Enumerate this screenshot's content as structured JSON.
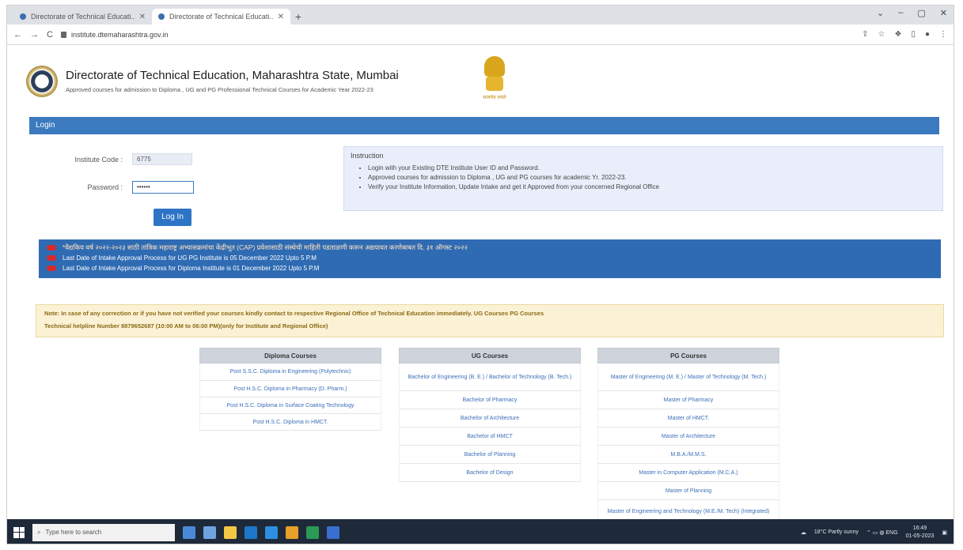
{
  "browser": {
    "tabs": [
      {
        "title": "Directorate of Technical Educati...",
        "active": false
      },
      {
        "title": "Directorate of Technical Educati...",
        "active": true
      }
    ],
    "new_tab": "+",
    "window_controls": [
      "⌄",
      "–",
      "▢",
      "✕"
    ],
    "url": "institute.dtemaharashtra.gov.in",
    "nav": [
      "←",
      "→",
      "C"
    ]
  },
  "header": {
    "title": "Directorate of Technical Education, Maharashtra State, Mumbai",
    "subtitle": "Approved courses for admission to Diploma , UG and PG Professional Technical Courses for Academic Year 2022-23",
    "emblem_text": "सत्यमेव जयते"
  },
  "login": {
    "bar_label": "Login",
    "institute_code_label": "Institute Code :",
    "institute_code_value": "6775",
    "password_label": "Password :",
    "password_value": "••••••",
    "button_label": "Log In"
  },
  "instruction": {
    "heading": "Instruction",
    "items": [
      "Login with your Existing DTE Institute User ID and Password.",
      "Approved courses for admission to Diploma , UG and PG courses for academic Yr. 2022-23.",
      "Verify your Institute Information, Update Intake and get it Approved from your concerned Regional Office"
    ]
  },
  "notices": [
    "*वैद्यकिय वर्ष २०२२-२०२३ साठी तांत्रिक महाराष्ट्र अभ्यासक्रमांचा केंद्रीभूत (CAP) प्रवेशासाठी संस्थेची माहिती पडताळणी करून अद्ययावत करणेबाबत दि. ३१ ऑगस्ट २०२२",
    "Last Date of Intake Approval Process for UG PG Institute is 05 December 2022 Upto 5 P.M",
    "Last Date of Intake Approval Process for Diploma Institute is 01 December 2022 Upto 5 P.M"
  ],
  "note": {
    "line1": "Note: In case of any correction or if you have not verified your courses kindly contact to respective Regional Office of Technical Education immediately. UG Courses PG Courses",
    "line2": "Technical helpline Number 8879652687 (10:00 AM to 06:00 PM)(only for Institute and Regional Office)"
  },
  "courses": {
    "diploma": {
      "header": "Diploma Courses",
      "items": [
        "Post S.S.C. Diploma in Engineering (Polytechnic)",
        "Post H.S.C. Diploma in Pharmacy (D. Pharm.)",
        "Post H.S.C. Diploma in Surface Coating Technology",
        "Post H.S.C. Diploma in HMCT."
      ]
    },
    "ug": {
      "header": "UG Courses",
      "items": [
        "Bachelor of Engineering (B. E.) / Bachelor of Technology (B. Tech.)",
        "Bachelor of Pharmacy",
        "Bachelor of Architecture",
        "Bachelor of HMCT",
        "Bachelor of Planning",
        "Bachelor of Design"
      ]
    },
    "pg": {
      "header": "PG Courses",
      "items": [
        "Master of Engineering (M. E.) / Master of Technology (M. Tech.)",
        "Master of Pharmacy",
        "Master of HMCT.",
        "Master of Architecture",
        "M.B.A./M.M.S.",
        "Master in Computer Application (M.C.A.)",
        "Master of Planning",
        "Master of Engineering and Technology (M.E./M. Tech) (Integrated)"
      ]
    }
  },
  "taskbar": {
    "search_placeholder": "Type here to search",
    "weather": "18°C Partly sunny",
    "time": "16:49",
    "date": "01-05-2023"
  }
}
